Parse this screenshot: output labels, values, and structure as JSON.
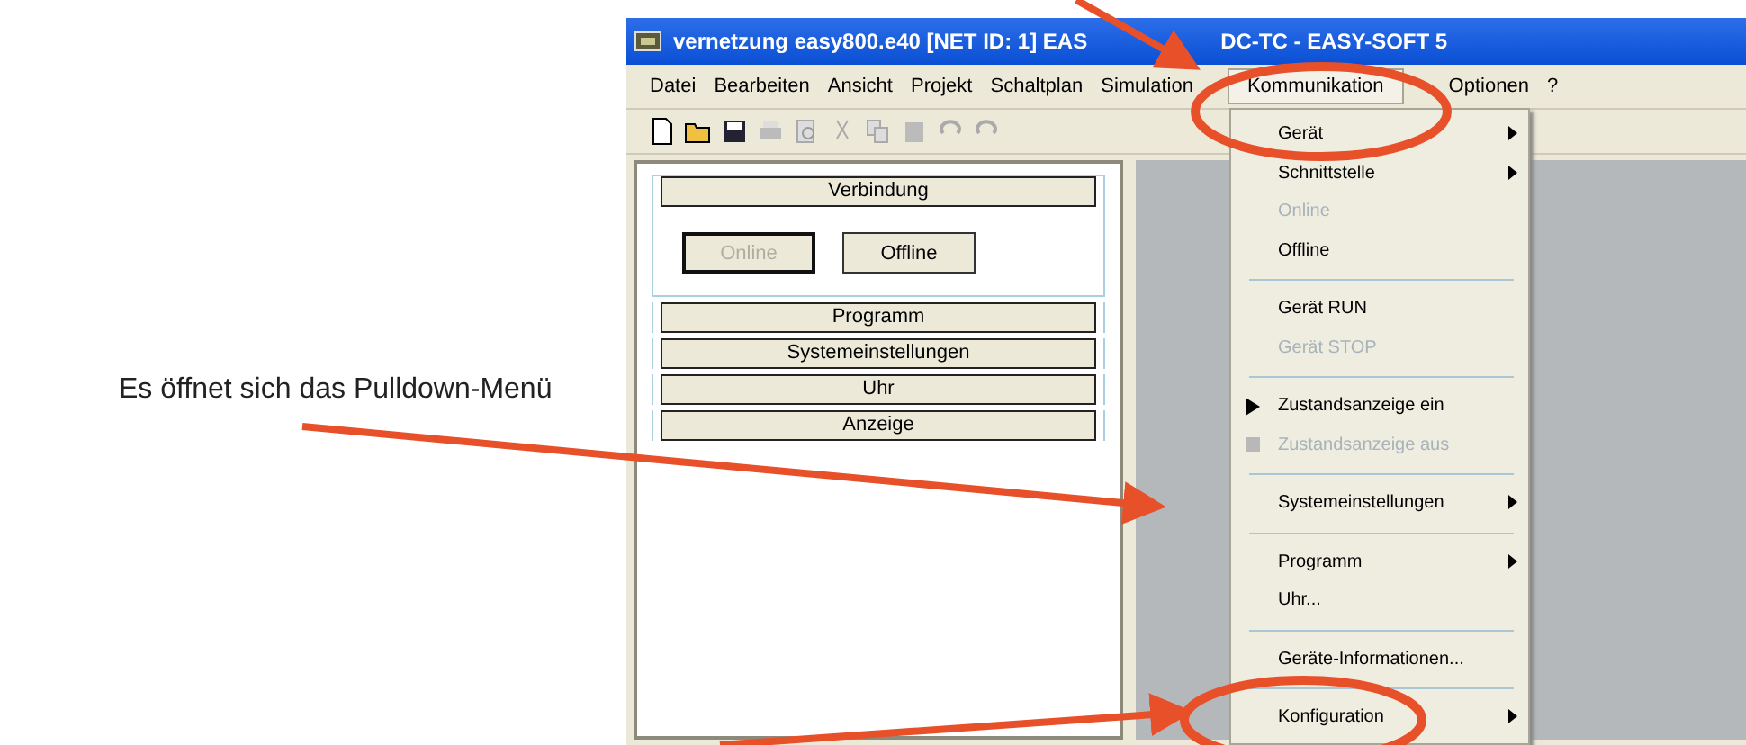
{
  "annotation": {
    "text": "Es öffnet sich das Pulldown-Menü"
  },
  "window": {
    "title_parts": [
      "vernetzung easy800.e40 [NET ID: 1] EAS",
      "DC-TC - EASY-SOFT 5"
    ]
  },
  "menu_bar": [
    {
      "label": "Datei",
      "selected": false
    },
    {
      "label": "Bearbeiten",
      "selected": false
    },
    {
      "label": "Ansicht",
      "selected": false
    },
    {
      "label": "Projekt",
      "selected": false
    },
    {
      "label": "Schaltplan",
      "selected": false
    },
    {
      "label": "Simulation",
      "selected": false
    },
    {
      "label": "Kommunikation",
      "selected": true
    },
    {
      "label": "Optionen",
      "selected": false
    },
    {
      "label": "?",
      "selected": false
    }
  ],
  "side_panel": {
    "sections": [
      {
        "label": "Verbindung",
        "expanded": true,
        "buttons": [
          {
            "label": "Online",
            "disabled": true
          },
          {
            "label": "Offline",
            "disabled": false
          }
        ]
      },
      {
        "label": "Programm",
        "expanded": false
      },
      {
        "label": "Systemeinstellungen",
        "expanded": false
      },
      {
        "label": "Uhr",
        "expanded": false
      },
      {
        "label": "Anzeige",
        "expanded": false
      }
    ]
  },
  "dropdown": [
    {
      "kind": "item",
      "label": "Gerät",
      "disabled": false,
      "submenu": true
    },
    {
      "kind": "item",
      "label": "Schnittstelle",
      "disabled": false,
      "submenu": true
    },
    {
      "kind": "item",
      "label": "Online",
      "disabled": true,
      "submenu": false
    },
    {
      "kind": "item",
      "label": "Offline",
      "disabled": false,
      "submenu": false
    },
    {
      "kind": "separator"
    },
    {
      "kind": "item",
      "label": "Gerät RUN",
      "disabled": false,
      "submenu": false
    },
    {
      "kind": "item",
      "label": "Gerät STOP",
      "disabled": true,
      "submenu": false
    },
    {
      "kind": "separator"
    },
    {
      "kind": "radio",
      "label": "Zustandsanzeige ein",
      "disabled": false,
      "selected": true
    },
    {
      "kind": "radio",
      "label": "Zustandsanzeige aus",
      "disabled": true,
      "selected": false
    },
    {
      "kind": "separator"
    },
    {
      "kind": "item",
      "label": "Systemeinstellungen",
      "disabled": false,
      "submenu": true
    },
    {
      "kind": "separator"
    },
    {
      "kind": "item",
      "label": "Programm",
      "disabled": false,
      "submenu": true
    },
    {
      "kind": "item",
      "label": "Uhr...",
      "disabled": false,
      "submenu": false
    },
    {
      "kind": "separator"
    },
    {
      "kind": "item",
      "label": "Geräte-Informationen...",
      "disabled": false,
      "submenu": false
    },
    {
      "kind": "separator"
    },
    {
      "kind": "item",
      "label": "Konfiguration",
      "disabled": false,
      "submenu": true
    }
  ]
}
